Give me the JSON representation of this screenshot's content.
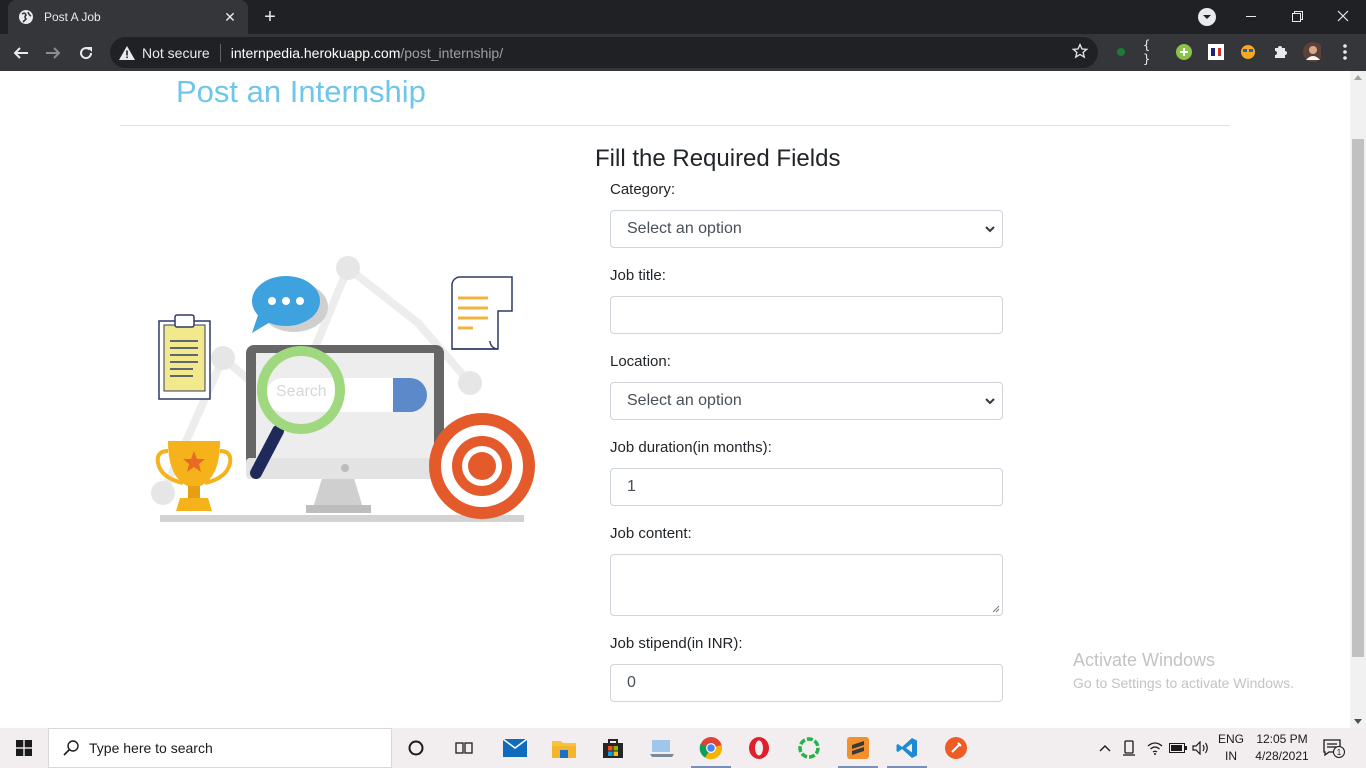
{
  "browser": {
    "tab_title": "Post A Job",
    "security_label": "Not secure",
    "url_host": "internpedia.herokuapp.com",
    "url_path": "/post_internship/"
  },
  "page": {
    "title": "Post an Internship",
    "form_heading": "Fill the Required Fields",
    "fields": {
      "category": {
        "label": "Category:",
        "value": "Select an option"
      },
      "job_title": {
        "label": "Job title:",
        "value": ""
      },
      "location": {
        "label": "Location:",
        "value": "Select an option"
      },
      "duration": {
        "label": "Job duration(in months):",
        "value": "1"
      },
      "content": {
        "label": "Job content:",
        "value": ""
      },
      "stipend": {
        "label": "Job stipend(in INR):",
        "value": "0"
      }
    },
    "illustration_search_text": "Search"
  },
  "watermark": {
    "line1": "Activate Windows",
    "line2": "Go to Settings to activate Windows."
  },
  "taskbar": {
    "search_placeholder": "Type here to search",
    "lang_top": "ENG",
    "lang_bottom": "IN",
    "time": "12:05 PM",
    "date": "4/28/2021",
    "notification_count": "1"
  },
  "colors": {
    "title_accent": "#6ec6ea",
    "chrome_dark": "#202124",
    "chrome_mid": "#35363a"
  }
}
